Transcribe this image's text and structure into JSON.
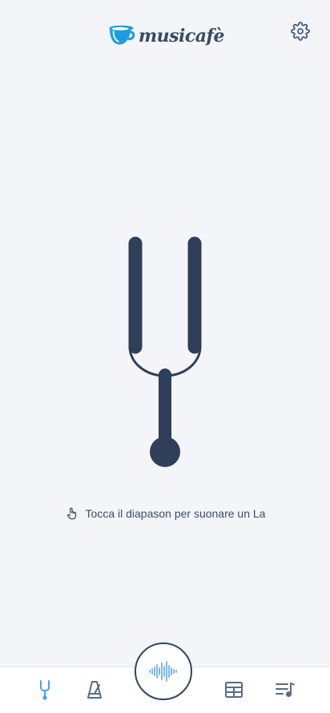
{
  "header": {
    "logo_text": "musicafè",
    "icons": {
      "logo": "coffee-cup-icon",
      "settings": "gear-icon"
    }
  },
  "main": {
    "hint_text": "Tocca il diapason per suonare un La",
    "icons": {
      "fork": "tuning-fork",
      "hint": "tap-hand-icon"
    }
  },
  "bottom_nav": {
    "items": [
      {
        "icon": "tuning-fork-icon",
        "active": true
      },
      {
        "icon": "metronome-icon",
        "active": false
      },
      {
        "icon": "sound-wave-icon",
        "active": false
      },
      {
        "icon": "layout-grid-icon",
        "active": false
      },
      {
        "icon": "playlist-music-icon",
        "active": false
      }
    ]
  },
  "colors": {
    "background": "#f4f5f9",
    "primary_dark": "#2f3f59",
    "accent_blue": "#1d9de0",
    "active_nav": "#4aa3e8"
  }
}
